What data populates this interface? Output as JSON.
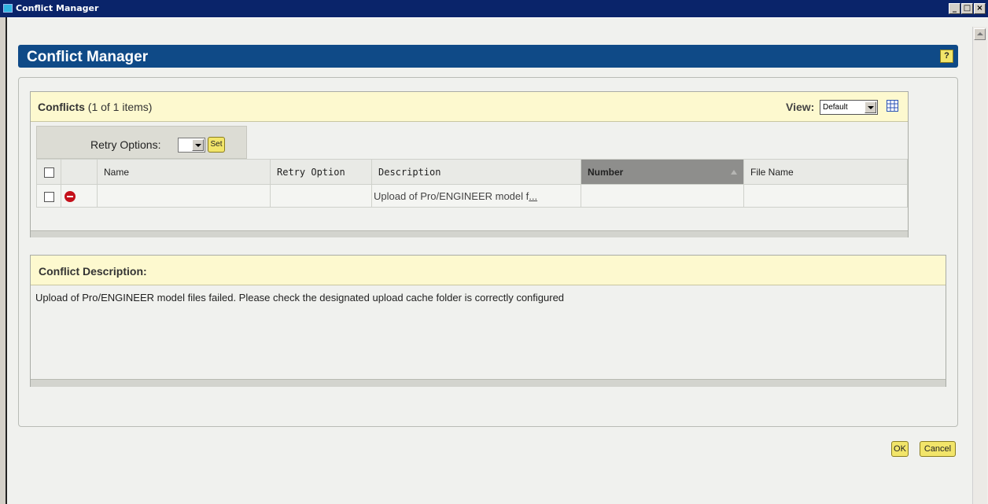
{
  "window": {
    "title": "Conflict Manager",
    "minimize_label": "_",
    "maximize_label": "□",
    "close_label": "×"
  },
  "header": {
    "title": "Conflict Manager",
    "help_label": "?"
  },
  "conflicts": {
    "title": "Conflicts",
    "count_text": "(1 of 1 items)",
    "view_label": "View:",
    "view_selected": "Default",
    "retry_label": "Retry Options:",
    "set_label": "Set",
    "columns": [
      "Name",
      "Retry Option",
      "Description",
      "Number",
      "File Name"
    ],
    "rows": [
      {
        "name": "",
        "retry_option": "",
        "description_prefix": "Upload of Pro/ENGINEER model f",
        "description_suffix": "...",
        "number": "",
        "file_name": ""
      }
    ]
  },
  "description": {
    "title": "Conflict Description:",
    "text": "Upload of Pro/ENGINEER model files failed. Please check the designated upload cache folder is correctly configured"
  },
  "actions": {
    "ok_label": "OK",
    "cancel_label": "Cancel"
  },
  "colors": {
    "title_bar": "#0a246a",
    "header_bar": "#0f4a87",
    "section_header": "#fdf9cf",
    "button_yellow": "#f2e56a",
    "error_icon": "#c4101a",
    "sorted_column": "#8e8e8c"
  },
  "icons": {
    "row_status": "stop-icon",
    "view_customize": "table-grid-icon"
  }
}
